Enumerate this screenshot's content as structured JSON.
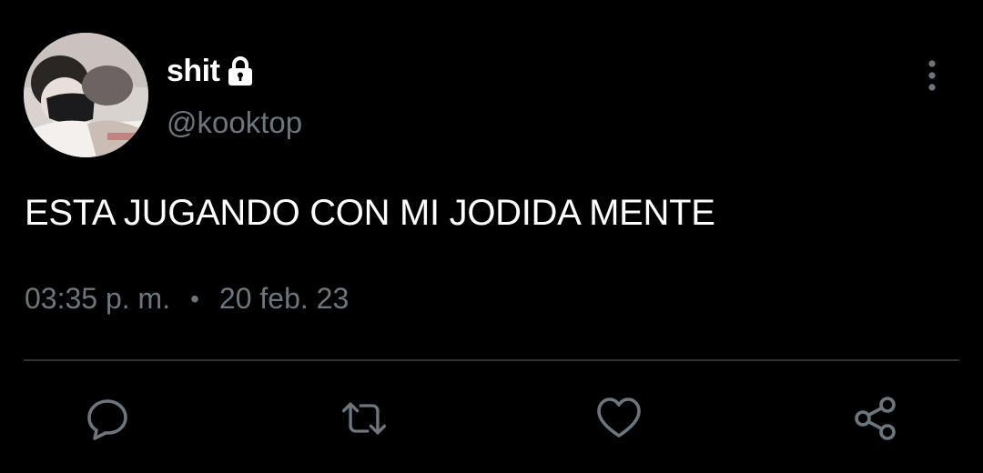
{
  "tweet": {
    "display_name": "shit",
    "handle": "@kooktop",
    "text": "ESTA JUGANDO CON MI JODIDA MENTE",
    "time": "03:35 p. m.",
    "separator": "•",
    "date": "20 feb. 23"
  },
  "icons": {
    "verified_lock": "lock-icon",
    "more": "more-vertical-icon",
    "reply": "reply-icon",
    "retweet": "retweet-icon",
    "like": "heart-icon",
    "share": "share-icon"
  },
  "colors": {
    "background": "#000000",
    "primary_text": "#ffffff",
    "secondary_text": "#6e767d",
    "divider": "#2f3336"
  }
}
